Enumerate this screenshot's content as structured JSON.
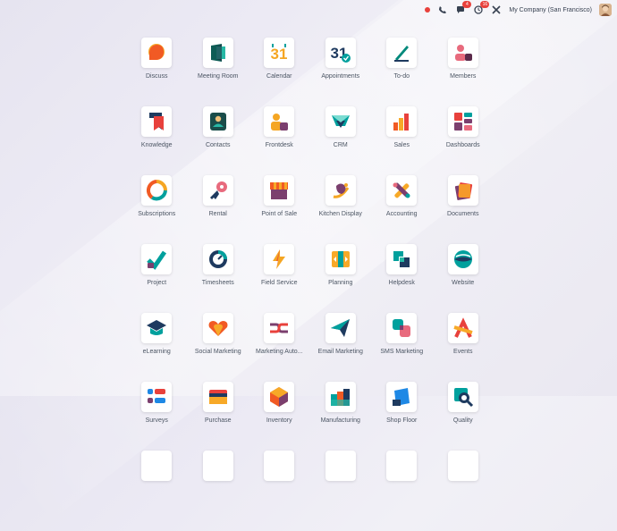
{
  "topbar": {
    "company": "My Company (San Francisco)",
    "chat_badge": "4",
    "activity_badge": "16"
  },
  "apps": [
    {
      "label": "Discuss",
      "icon": "discuss-icon"
    },
    {
      "label": "Meeting Room",
      "icon": "meeting-room-icon"
    },
    {
      "label": "Calendar",
      "icon": "calendar-icon",
      "num": "31"
    },
    {
      "label": "Appointments",
      "icon": "appointments-icon",
      "num": "31"
    },
    {
      "label": "To-do",
      "icon": "todo-icon"
    },
    {
      "label": "Members",
      "icon": "members-icon"
    },
    {
      "label": "Knowledge",
      "icon": "knowledge-icon"
    },
    {
      "label": "Contacts",
      "icon": "contacts-icon"
    },
    {
      "label": "Frontdesk",
      "icon": "frontdesk-icon"
    },
    {
      "label": "CRM",
      "icon": "crm-icon"
    },
    {
      "label": "Sales",
      "icon": "sales-icon"
    },
    {
      "label": "Dashboards",
      "icon": "dashboards-icon"
    },
    {
      "label": "Subscriptions",
      "icon": "subscriptions-icon"
    },
    {
      "label": "Rental",
      "icon": "rental-icon"
    },
    {
      "label": "Point of Sale",
      "icon": "point-of-sale-icon"
    },
    {
      "label": "Kitchen Display",
      "icon": "kitchen-display-icon"
    },
    {
      "label": "Accounting",
      "icon": "accounting-icon"
    },
    {
      "label": "Documents",
      "icon": "documents-icon"
    },
    {
      "label": "Project",
      "icon": "project-icon"
    },
    {
      "label": "Timesheets",
      "icon": "timesheets-icon"
    },
    {
      "label": "Field Service",
      "icon": "field-service-icon"
    },
    {
      "label": "Planning",
      "icon": "planning-icon"
    },
    {
      "label": "Helpdesk",
      "icon": "helpdesk-icon"
    },
    {
      "label": "Website",
      "icon": "website-icon"
    },
    {
      "label": "eLearning",
      "icon": "elearning-icon"
    },
    {
      "label": "Social Marketing",
      "icon": "social-marketing-icon"
    },
    {
      "label": "Marketing Auto...",
      "icon": "marketing-automation-icon"
    },
    {
      "label": "Email Marketing",
      "icon": "email-marketing-icon"
    },
    {
      "label": "SMS Marketing",
      "icon": "sms-marketing-icon"
    },
    {
      "label": "Events",
      "icon": "events-icon"
    },
    {
      "label": "Surveys",
      "icon": "surveys-icon"
    },
    {
      "label": "Purchase",
      "icon": "purchase-icon"
    },
    {
      "label": "Inventory",
      "icon": "inventory-icon"
    },
    {
      "label": "Manufacturing",
      "icon": "manufacturing-icon"
    },
    {
      "label": "Shop Floor",
      "icon": "shop-floor-icon"
    },
    {
      "label": "Quality",
      "icon": "quality-icon"
    },
    {
      "label": "",
      "icon": "app-icon"
    },
    {
      "label": "",
      "icon": "app-icon"
    },
    {
      "label": "",
      "icon": "app-icon"
    },
    {
      "label": "",
      "icon": "app-icon"
    },
    {
      "label": "",
      "icon": "app-icon"
    },
    {
      "label": "",
      "icon": "app-icon"
    }
  ]
}
